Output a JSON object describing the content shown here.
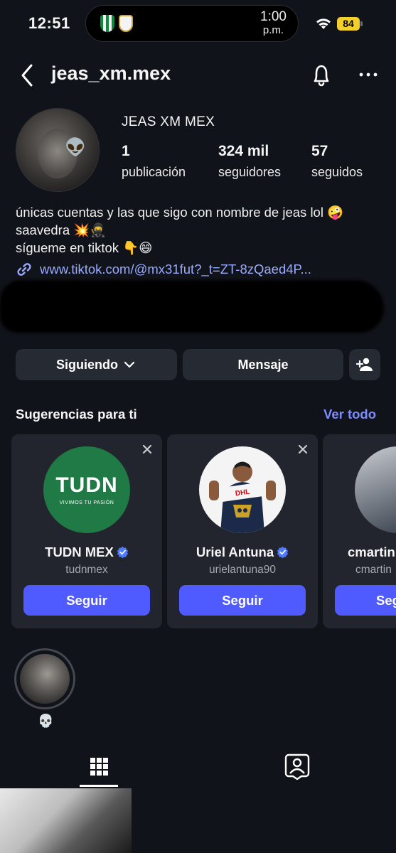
{
  "status_bar": {
    "time": "12:51",
    "island_time": "1:00",
    "island_ampm": "p.m.",
    "battery": "84",
    "icons": [
      "betis-crest-icon",
      "real-madrid-crest-icon",
      "wifi-icon"
    ]
  },
  "header": {
    "username": "jeas_xm.mex",
    "icons": [
      "back-icon",
      "bell-icon",
      "more-icon"
    ]
  },
  "profile": {
    "display_name": "JEAS XM MEX",
    "avatar_emoji": "👽",
    "stats": [
      {
        "value": "1",
        "label": "publicación"
      },
      {
        "value": "324 mil",
        "label": "seguidores"
      },
      {
        "value": "57",
        "label": "seguidos"
      }
    ],
    "bio_lines": [
      "únicas cuentas y las que sigo con nombre de jeas lol 🤪",
      "saavedra 💥🥷",
      "sígueme en tiktok 👇😄"
    ],
    "link": "www.tiktok.com/@mx31fut?_t=ZT-8zQaed4P..."
  },
  "actions": {
    "following_label": "Siguiendo",
    "message_label": "Mensaje"
  },
  "suggestions": {
    "title": "Sugerencias para ti",
    "see_all": "Ver todo",
    "cards": [
      {
        "name": "TUDN MEX",
        "handle": "tudnmex",
        "follow": "Seguir",
        "logo_text": "TUDN",
        "logo_sub": "VIVIMOS TU PASIÓN"
      },
      {
        "name": "Uriel Antuna",
        "handle": "urielantuna90",
        "follow": "Seguir"
      },
      {
        "name": "cmartin",
        "handle": "cmartin",
        "follow": "Seg"
      }
    ]
  },
  "highlights": [
    {
      "label": "💀"
    }
  ],
  "colors": {
    "background": "#11131a",
    "button_bg": "#262a33",
    "accent": "#4f5bff",
    "link": "#9aaaff",
    "verified": "#4f7bff"
  }
}
